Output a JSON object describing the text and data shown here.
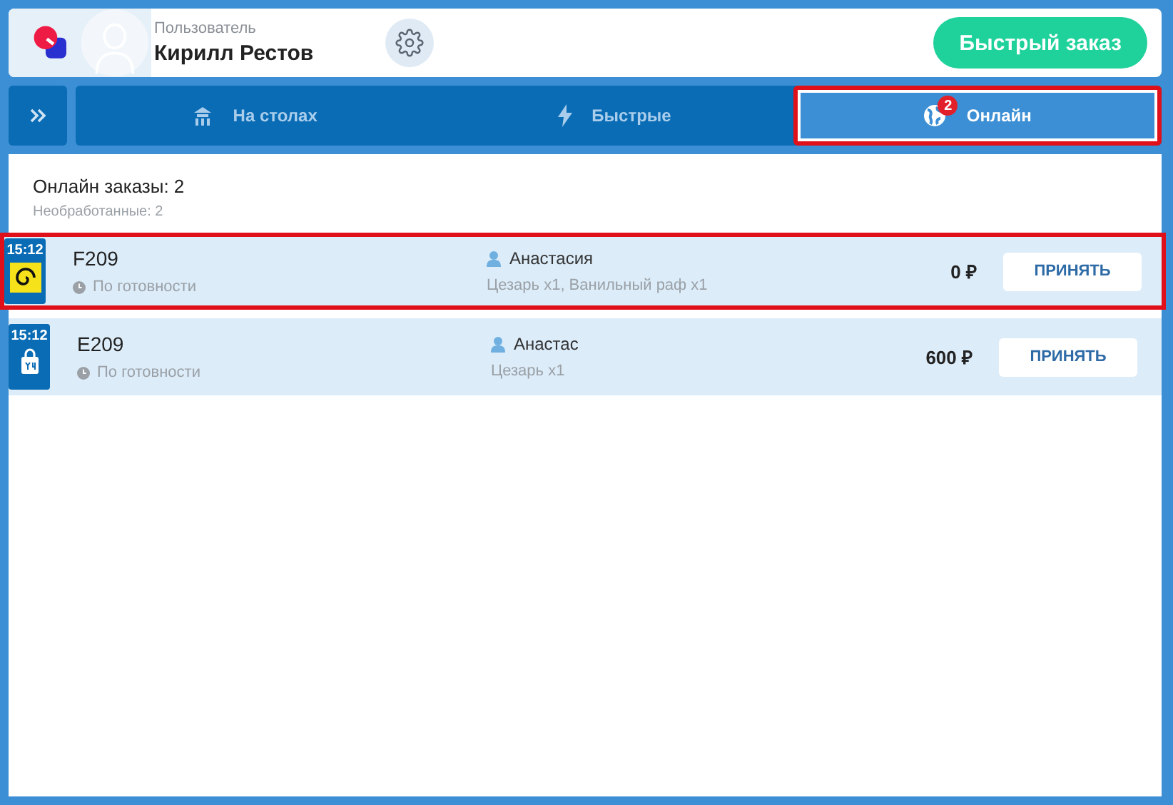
{
  "header": {
    "user_caption": "Пользователь",
    "user_name": "Кирилл Рестов",
    "quick_order_button": "Быстрый заказ"
  },
  "tabs": [
    {
      "label": "На столах",
      "kind": "tables",
      "selected": false,
      "highlighted": false
    },
    {
      "label": "Быстрые",
      "kind": "bolt",
      "selected": false,
      "highlighted": false
    },
    {
      "label": "Онлайн",
      "kind": "globe",
      "badge": "2",
      "selected": true,
      "highlighted": true
    }
  ],
  "summary": {
    "title": "Онлайн заказы: 2",
    "subtitle": "Необработанные: 2"
  },
  "orders": [
    {
      "time": "15:12",
      "kind": "spiral",
      "number": "F209",
      "timing": "По готовности",
      "customer": "Анастасия",
      "items": "Цезарь x1, Ванильный раф x1",
      "total": "0 ₽",
      "action": "ПРИНЯТЬ",
      "highlighted": true
    },
    {
      "time": "15:12",
      "kind": "bag",
      "number": "E209",
      "timing": "По готовности",
      "customer": "Анастас",
      "items": "Цезарь x1",
      "total": "600 ₽",
      "action": "ПРИНЯТЬ",
      "highlighted": false
    }
  ]
}
